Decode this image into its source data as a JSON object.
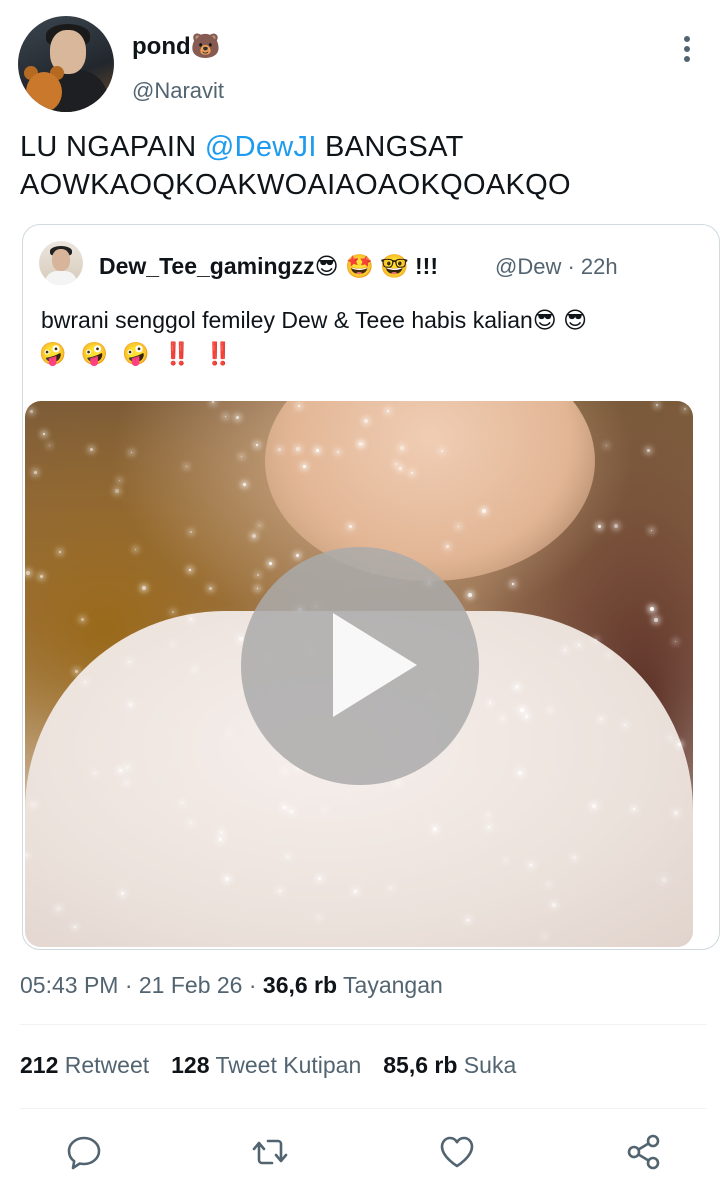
{
  "tweet": {
    "author_name": "pond🐻",
    "author_handle": "@Naravit",
    "text_before": "LU NGAPAIN ",
    "mention": "@DewJI",
    "text_after": " BANGSAT AOWKAOQKOAKWOAIAOAOKQOAKQO",
    "time": "05:43 PM · 21 Feb 26 · ",
    "views_count": "36,6 rb",
    "views_label": " Tayangan"
  },
  "quote": {
    "name": "Dew_Tee_gamingzz😎 🤩 🤓 !!!",
    "meta": "@Dew · 22h",
    "text": "bwrani senggol femiley Dew & Teee habis kalian😎 😎",
    "text2": "🤪 🤪 🤪 ‼️ ‼️"
  },
  "stats": {
    "retweets_count": "212",
    "retweets_label": " Retweet",
    "quotes_count": "128",
    "quotes_label": " Tweet Kutipan",
    "likes_count": "85,6 rb",
    "likes_label": " Suka"
  },
  "icons": {
    "more": "more-vertical-icon",
    "reply": "reply-icon",
    "retweet": "retweet-icon",
    "like": "heart-icon",
    "share": "share-icon",
    "play": "play-icon"
  },
  "colors": {
    "mention": "#1d9bf0",
    "secondary_text": "#536471",
    "border": "#cfd9de",
    "icon": "#536471"
  }
}
